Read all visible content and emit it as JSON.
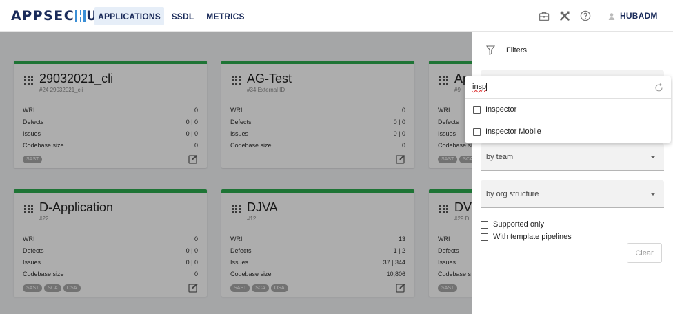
{
  "app": {
    "logo_text_left": "APPSEC",
    "logo_text_right": "UB"
  },
  "nav": {
    "tabs": [
      {
        "label": "APPLICATIONS",
        "active": true
      },
      {
        "label": "SSDL",
        "active": false
      },
      {
        "label": "METRICS",
        "active": false
      }
    ],
    "icons": [
      "briefcase-icon",
      "tools-icon",
      "help-icon"
    ],
    "user": "HUBADM"
  },
  "cards": [
    {
      "title": "29032021_cli",
      "subtitle": "#24 29032021_cli",
      "wri": "0",
      "defects": "0 | 0",
      "issues": "0 | 0",
      "codebase": "0",
      "tags": [
        "SAST"
      ]
    },
    {
      "title": "AG-Test",
      "subtitle": "#34 External ID",
      "wri": "0",
      "defects": "0 | 0",
      "issues": "0 | 0",
      "codebase": "0",
      "tags": []
    },
    {
      "title": "Ap",
      "subtitle": "#9",
      "wri": "",
      "defects": "",
      "issues": "",
      "codebase": "",
      "tags": [
        "SAST",
        "SCA"
      ]
    },
    {
      "title": "D-Application",
      "subtitle": "#22",
      "wri": "0",
      "defects": "0 | 0",
      "issues": "0 | 0",
      "codebase": "0",
      "tags": [
        "SAST",
        "SCA",
        "OSA"
      ]
    },
    {
      "title": "DJVA",
      "subtitle": "#12",
      "wri": "13",
      "defects": "1 | 2",
      "issues": "37 | 344",
      "codebase": "10,806",
      "tags": [
        "SAST",
        "SCA",
        "OSA"
      ]
    },
    {
      "title": "DV",
      "subtitle": "#29 D",
      "wri": "",
      "defects": "",
      "issues": "",
      "codebase": "",
      "tags": [
        "SAST"
      ]
    }
  ],
  "metric_labels": {
    "wri": "WRI",
    "defects": "Defects",
    "issues": "Issues",
    "codebase": "Codebase size",
    "codebase_short": "Codebase s"
  },
  "filters": {
    "title": "Filters",
    "team_select": "by team",
    "org_select": "by org structure",
    "supported_only": "Supported only",
    "with_pipelines": "With template pipelines",
    "clear_label": "Clear"
  },
  "dropdown": {
    "search_value": "insp",
    "options": [
      "Inspector",
      "Inspector Mobile"
    ]
  },
  "colors": {
    "accent": "#2dab4e",
    "brand": "#1a2b5a",
    "nav_active": "#e6eef8"
  }
}
